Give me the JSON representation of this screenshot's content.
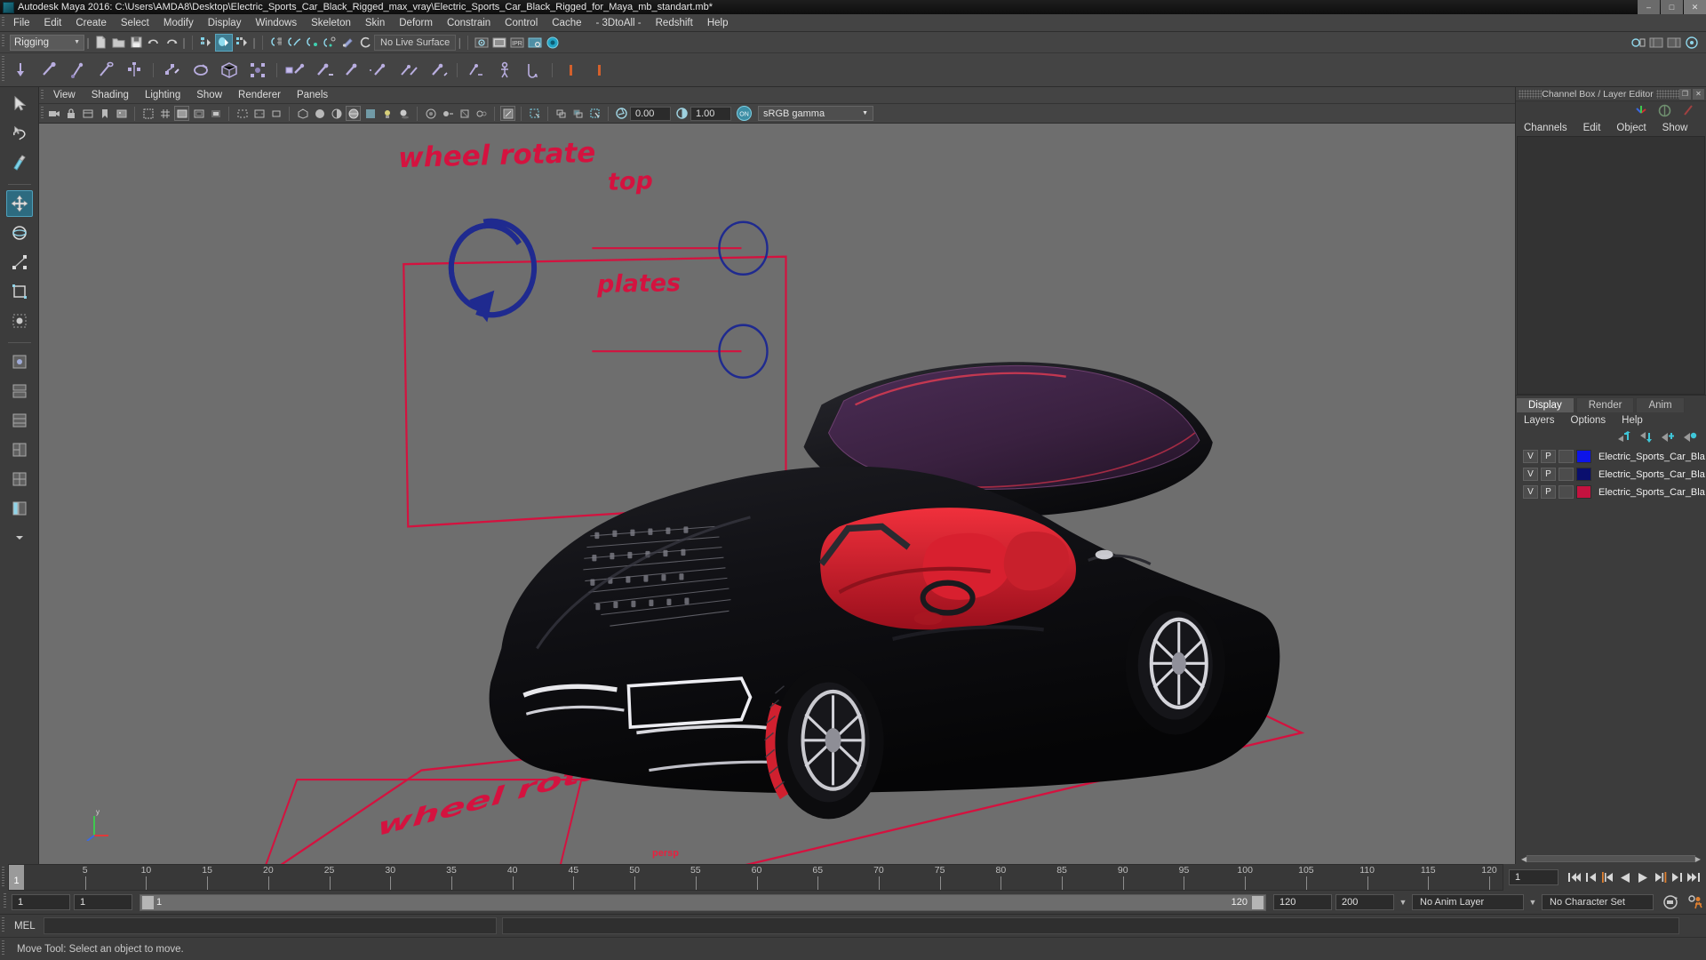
{
  "window": {
    "title": "Autodesk Maya 2016: C:\\Users\\AMDA8\\Desktop\\Electric_Sports_Car_Black_Rigged_max_vray\\Electric_Sports_Car_Black_Rigged_for_Maya_mb_standart.mb*",
    "minimize": "–",
    "maximize": "□",
    "close": "✕"
  },
  "menubar": {
    "items": [
      "File",
      "Edit",
      "Create",
      "Select",
      "Modify",
      "Display",
      "Windows",
      "Skeleton",
      "Skin",
      "Deform",
      "Constrain",
      "Control",
      "Cache",
      "- 3DtoAll -",
      "Redshift",
      "Help"
    ]
  },
  "statusbar": {
    "menuset": "Rigging",
    "live_surface": "No Live Surface",
    "icons": [
      "new-scene-icon",
      "open-scene-icon",
      "save-scene-icon",
      "undo-icon",
      "redo-icon",
      "select-by-hierarchy-icon",
      "select-by-object-icon",
      "select-by-component-icon",
      "snap-to-grid-icon",
      "snap-to-curve-icon",
      "snap-to-point-icon",
      "snap-to-projected-center-icon",
      "snap-to-view-plane-icon",
      "make-live-icon",
      "render-view-icon",
      "render-current-frame-icon",
      "ipr-render-icon",
      "render-settings-icon",
      "hypershade-icon"
    ]
  },
  "shelf": {
    "icons": [
      "create-joint-icon",
      "insert-joint-icon",
      "reroot-skeleton-icon",
      "remove-joint-icon",
      "mirror-joint-icon",
      "ik-handle-icon",
      "ik-spline-handle-icon",
      "lattice-deform-icon",
      "cluster-icon",
      "bind-skin-icon",
      "interactive-bind-icon",
      "detach-skin-icon",
      "paint-skin-weights-icon",
      "mirror-skin-weights-icon",
      "copy-skin-weights-icon",
      "quick-rig-icon",
      "human-ik-icon",
      "pose-deformer-icon",
      "constraint-icon",
      "parent-constraint-icon"
    ]
  },
  "toolbox": {
    "items": [
      {
        "name": "select-tool-icon",
        "selected": false
      },
      {
        "name": "lasso-select-tool-icon",
        "selected": false
      },
      {
        "name": "paint-select-tool-icon",
        "selected": false
      },
      {
        "name": "move-tool-icon",
        "selected": true
      },
      {
        "name": "rotate-tool-icon",
        "selected": false
      },
      {
        "name": "scale-tool-icon",
        "selected": false
      },
      {
        "name": "universal-manipulator-icon",
        "selected": false
      },
      {
        "name": "soft-modification-tool-icon",
        "selected": false
      },
      {
        "name": "layout-single-pane-icon",
        "selected": false
      },
      {
        "name": "layout-two-pane-side-icon",
        "selected": false
      },
      {
        "name": "layout-two-pane-stacked-icon",
        "selected": false
      },
      {
        "name": "layout-three-pane-icon",
        "selected": false
      },
      {
        "name": "layout-four-pane-icon",
        "selected": false
      },
      {
        "name": "layout-persp-outliner-icon",
        "selected": false
      },
      {
        "name": "layout-more-icon",
        "selected": false
      }
    ]
  },
  "viewport": {
    "menus": [
      "View",
      "Shading",
      "Lighting",
      "Show",
      "Renderer",
      "Panels"
    ],
    "exposure": "0.00",
    "gamma": "1.00",
    "color_management_toggle": "ON",
    "color_profile": "sRGB gamma",
    "camera_label": "persp",
    "toolbar_icons": [
      "select-camera-icon",
      "lock-camera-icon",
      "camera-attributes-icon",
      "bookmarks-icon",
      "image-plane-icon",
      "two-d-pan-zoom-icon",
      "grid-toggle-icon",
      "film-gate-icon",
      "resolution-gate-icon",
      "gate-mask-icon",
      "field-chart-icon",
      "safe-action-icon",
      "safe-title-icon",
      "wireframe-icon",
      "smooth-shade-all-icon",
      "smooth-shade-selected-icon",
      "wireframe-on-shaded-icon",
      "texture-toggle-icon",
      "light-toggle-icon",
      "shadows-toggle-icon",
      "screen-space-ao-icon",
      "motion-blur-icon",
      "multisample-icon",
      "depth-of-field-icon",
      "isolate-select-icon",
      "xray-toggle-icon",
      "xray-joints-icon",
      "xray-active-components-icon",
      "exposure-icon",
      "gamma-icon"
    ],
    "annotations": [
      {
        "name": "annotation-wheel-rotate",
        "text": "wheel rotate",
        "color": "#d4123f"
      },
      {
        "name": "annotation-top",
        "text": "top",
        "color": "#d4123f"
      },
      {
        "name": "annotation-plates",
        "text": "plates",
        "color": "#d4123f"
      },
      {
        "name": "annotation-reflection",
        "text": "wheel rotate",
        "color": "#d4123f"
      }
    ],
    "colors": {
      "background": "#6e6e6e",
      "annotation_red": "#d4123f",
      "annotation_blue": "#1f2a8f",
      "car_body": "#0b0b0d",
      "car_interior": "#e0202f",
      "glass": "#3a2240"
    }
  },
  "channelbox": {
    "title": "Channel Box / Layer Editor",
    "menus": [
      "Channels",
      "Edit",
      "Object",
      "Show"
    ],
    "header_icons": [
      "channel-box-icon",
      "attribute-editor-icon",
      "modeling-toolkit-icon"
    ]
  },
  "layer_editor": {
    "tabs": [
      {
        "label": "Display",
        "active": true
      },
      {
        "label": "Render",
        "active": false
      },
      {
        "label": "Anim",
        "active": false
      }
    ],
    "menus": [
      "Layers",
      "Options",
      "Help"
    ],
    "buttons": [
      "move-layer-up-icon",
      "move-layer-down-icon",
      "new-layer-icon",
      "new-layer-from-selected-icon"
    ],
    "columns": [
      "V",
      "P",
      ""
    ],
    "layers": [
      {
        "visible": "V",
        "playback": "P",
        "third": "",
        "color": "#0d14e8",
        "name": "Electric_Sports_Car_Bla"
      },
      {
        "visible": "V",
        "playback": "P",
        "third": "",
        "color": "#0a0f6e",
        "name": "Electric_Sports_Car_Bla"
      },
      {
        "visible": "V",
        "playback": "P",
        "third": "",
        "color": "#c4123f",
        "name": "Electric_Sports_Car_Bla"
      }
    ]
  },
  "timeline": {
    "current_frame": "1",
    "start_field": "1",
    "end_field": "1",
    "range_start": "1",
    "range_end": "120",
    "anim_start": "120",
    "anim_end": "200",
    "playback_frame": "1",
    "ticks": [
      5,
      10,
      15,
      20,
      25,
      30,
      35,
      40,
      45,
      50,
      55,
      60,
      65,
      70,
      75,
      80,
      85,
      90,
      95,
      100,
      105,
      110,
      115,
      120
    ],
    "anim_layer": "No Anim Layer",
    "character_set": "No Character Set",
    "playback_buttons": [
      "go-to-start-icon",
      "step-back-frame-icon",
      "step-back-key-icon",
      "play-backwards-icon",
      "play-forwards-icon",
      "step-forward-key-icon",
      "step-forward-frame-icon",
      "go-to-end-icon"
    ],
    "extra_buttons": [
      "auto-key-icon",
      "animation-preferences-icon"
    ]
  },
  "commandline": {
    "language_label": "MEL",
    "input_value": "",
    "output_value": ""
  },
  "helpline": {
    "text": "Move Tool: Select an object to move."
  }
}
